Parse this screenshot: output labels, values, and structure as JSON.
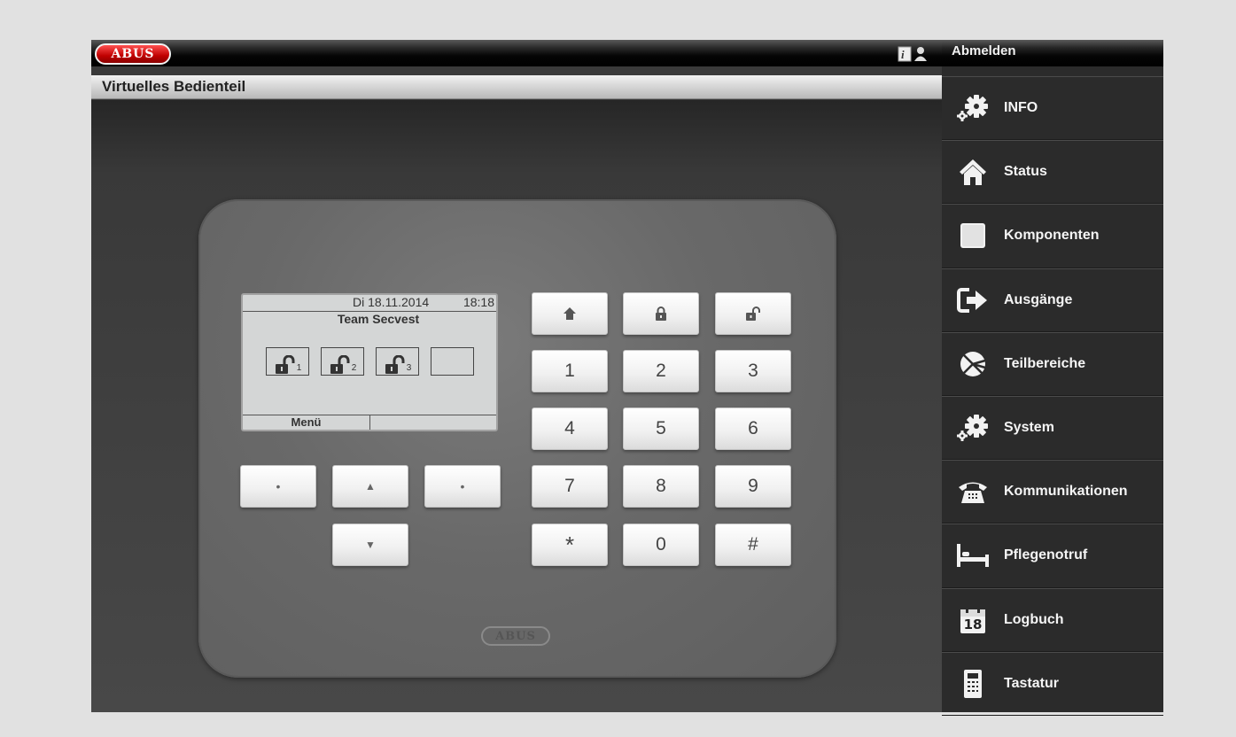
{
  "app": {
    "logo": "ABUS",
    "title": "Virtuelles Bedienteil"
  },
  "header": {
    "user_icon": "user-info-icon",
    "logout_label": "Abmelden"
  },
  "display": {
    "date": "Di 18.11.2014",
    "time": "18:18",
    "name": "Team Secvest",
    "zones": [
      {
        "number": "1",
        "icon": "unlocked-icon"
      },
      {
        "number": "2",
        "icon": "unlocked-icon"
      },
      {
        "number": "3",
        "icon": "unlocked-icon"
      },
      {
        "number": "",
        "icon": ""
      }
    ],
    "softkey_left": "Menü",
    "softkey_right": ""
  },
  "keypad": {
    "function_keys": [
      "home-icon",
      "lock-icon",
      "unlock-icon"
    ],
    "digits": [
      "1",
      "2",
      "3",
      "4",
      "5",
      "6",
      "7",
      "8",
      "9",
      "*",
      "0",
      "#"
    ],
    "nav_left_symbol": "•",
    "nav_right_symbol": "•",
    "nav_up_symbol": "▲",
    "nav_down_symbol": "▼"
  },
  "device_brand": "ABUS",
  "sidebar": {
    "items": [
      {
        "label": "INFO",
        "icon": "gears-icon"
      },
      {
        "label": "Status",
        "icon": "house-icon"
      },
      {
        "label": "Komponenten",
        "icon": "square-icon"
      },
      {
        "label": "Ausgänge",
        "icon": "output-arrow-icon"
      },
      {
        "label": "Teilbereiche",
        "icon": "partitions-icon"
      },
      {
        "label": "System",
        "icon": "gears-icon"
      },
      {
        "label": "Kommunikationen",
        "icon": "telephone-icon"
      },
      {
        "label": "Pflegenotruf",
        "icon": "bed-icon"
      },
      {
        "label": "Logbuch",
        "icon": "calendar-icon"
      },
      {
        "label": "Tastatur",
        "icon": "remote-keypad-icon"
      }
    ],
    "calendar_day": "18"
  },
  "colors": {
    "brand_red": "#cc0000",
    "sidebar_bg": "#2b2b2b",
    "lcd_bg": "#d4d6d6",
    "key_bg": "#f1f1f1"
  }
}
